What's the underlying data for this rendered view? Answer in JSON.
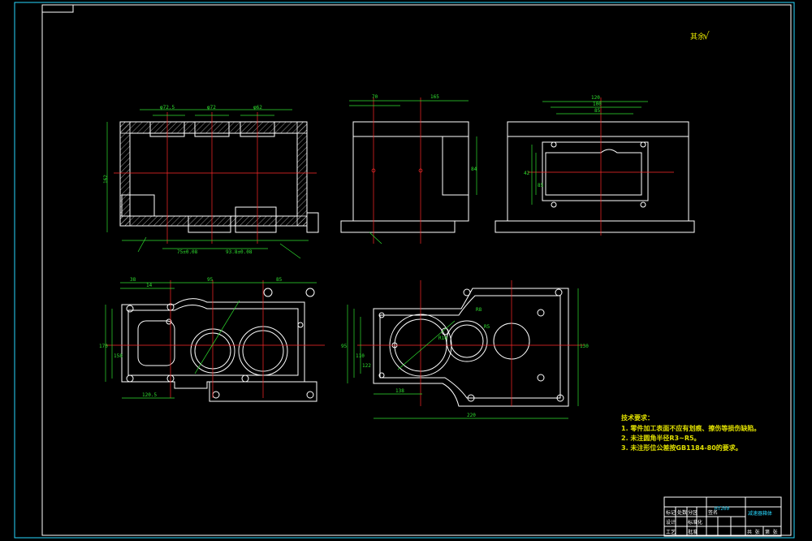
{
  "drawing": {
    "roughness_mark": "其余",
    "roughness_symbol": "√",
    "technical_requirements": {
      "title": "技术要求：",
      "items": [
        "1. 零件加工表面不应有划痕、擦伤等损伤缺陷。",
        "2. 未注圆角半径R3~R5。",
        "3. 未注形位公差按GB1184-80的要求。"
      ]
    },
    "title_block": {
      "material": "HT200",
      "part_name": "减速器箱体",
      "row_labels": [
        "标记",
        "处数",
        "分区",
        "更改文件号",
        "签名",
        "年月日"
      ],
      "row2_labels": [
        "设计",
        "",
        "标准化",
        "",
        "阶段标记",
        "重量",
        "比例"
      ],
      "row3_labels": [
        "审核",
        "",
        "",
        "",
        "",
        ""
      ],
      "row4_labels": [
        "工艺",
        "",
        "批准",
        "",
        "共 张",
        "第 张"
      ]
    },
    "dims": {
      "top_front": [
        "φ72.5",
        "φ72",
        "φ62"
      ],
      "left_height": "162",
      "front_bottom": [
        "75±0.08",
        "93.8±0.08"
      ],
      "side_top": [
        "70",
        "165"
      ],
      "side_height": "84",
      "right_top": [
        "120",
        "100",
        "85"
      ],
      "right_height": [
        "42",
        "85"
      ],
      "plan_top": [
        "38",
        "14",
        "95",
        "85"
      ],
      "plan_left": [
        "170",
        "158",
        "100"
      ],
      "plan_bottom": [
        "120.5"
      ],
      "plan2_width": "220",
      "plan2_height": "130",
      "plan2_left": [
        "95",
        "110",
        "122"
      ],
      "plan2_bottom": [
        "138"
      ],
      "callout": [
        "R8",
        "R5",
        "R10"
      ]
    }
  }
}
